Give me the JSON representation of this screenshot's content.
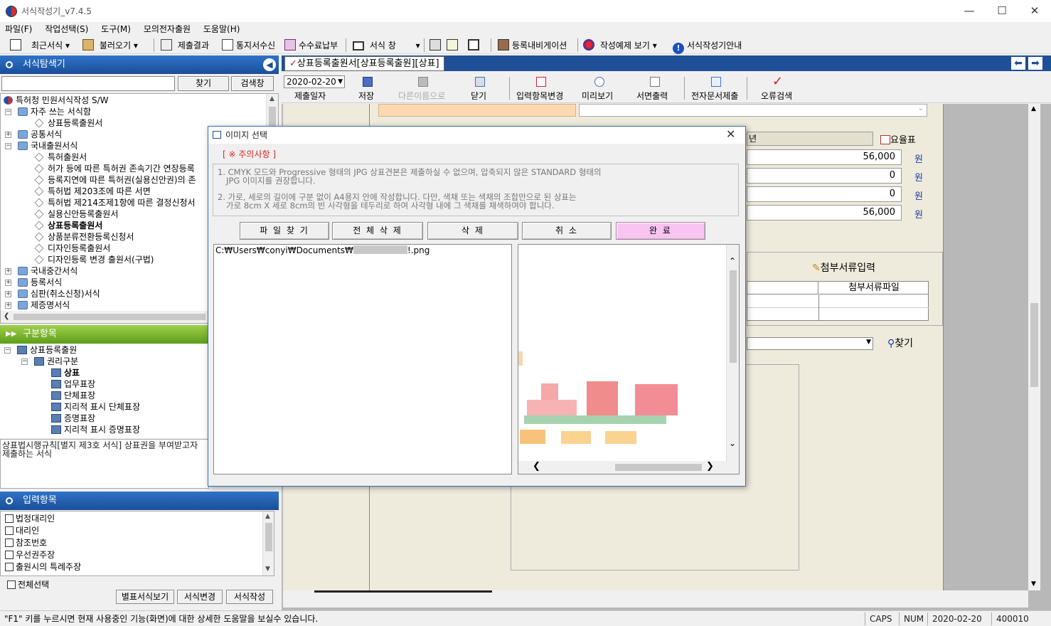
{
  "window": {
    "title": "서식작성기_v7.4.5"
  },
  "menu": [
    "파일(F)",
    "작업선택(S)",
    "도구(M)",
    "모의전자출원",
    "도움말(H)"
  ],
  "toolbar": {
    "recent": "최근서식",
    "load": "불러오기",
    "submit_result": "제출결과",
    "notice_receive": "통지서수신",
    "fee_pay": "수수료납부",
    "form_window": "서식 창",
    "reg_navigation": "등록내비게이션",
    "example_view": "작성예제 보기",
    "guide": "서식작성기안내"
  },
  "explorer": {
    "header": "서식탐색기",
    "find_button": "찾기",
    "search_window_button": "검색창",
    "tree": [
      "특허청 민원서식작성 S/W",
      "자주 쓰는 서식함",
      "상표등록출원서",
      "공통서식",
      "국내출원서식",
      "특허출원서",
      "허가 등에 따른 특허권 존속기간 연장등록",
      "등록지연에 따른 특허권(실용신안권)의 존",
      "특허법 제203조에 따른 서면",
      "특허법 제214조제1항에 따른 결정신청서",
      "실용신안등록출원서",
      "상표등록출원서",
      "상품분류전환등록신청서",
      "디자인등록출원서",
      "디자인등록 변경 출원서(구법)",
      "국내중간서식",
      "등록서식",
      "심판(취소신청)서식",
      "제증명서식"
    ]
  },
  "category": {
    "header": "구분항목",
    "tree": [
      "상표등록출원",
      "권리구분",
      "상표",
      "업무표장",
      "단체표장",
      "지리적 표시 단체표장",
      "증명표장",
      "지리적 표시 증명표장"
    ],
    "description": "상표법시행규칙[별지 제3호 서식] 상표권을 부여받고자 제출하는 서식"
  },
  "inputs": {
    "header": "입력항목",
    "items": [
      "법정대리인",
      "대리인",
      "참조번호",
      "우선권주장",
      "출원시의 특례주장"
    ],
    "select_all": "전체선택",
    "btn_appendix": "별표서식보기",
    "btn_change": "서식변경",
    "btn_write": "서식작성"
  },
  "document": {
    "tab": "상표등록출원서[상표등록출원][상표]",
    "date": "2020-02-20",
    "toolbar": [
      "제출일자",
      "저장",
      "다른이름으로",
      "닫기",
      "입력항목변경",
      "미리보기",
      "서면출력",
      "전자문서제출",
      "오류검색"
    ],
    "fee_label": "요율표",
    "fees": [
      "56,000",
      "0",
      "0",
      "56,000"
    ],
    "won": "원",
    "attach_input": "첨부서류입력",
    "attach_file_col": "첨부서류파일",
    "find": "찾기"
  },
  "dialog": {
    "title": "이미지 선택",
    "notice_title": "[ ※ 주의사항 ]",
    "note1a": "1. CMYK 모드와 Progressive 형태의 JPG 상표견본은 제출하실 수 없으며, 압축되지 않은 STANDARD 형태의",
    "note1b": "JPG 이미지를 권장합니다.",
    "note2a": "2. 가로, 세로의 길이에 구분 없이 A4용지 안에 작성합니다. 다만, 색채 또는 색채의 조합만으로 된 상표는",
    "note2b": "가로 8cm X 세로 8cm의 빈 사각형을 테두리로 하여 사각형 내에 그 색채를 채색하여야 합니다.",
    "btn_find": "파 일 찾 기",
    "btn_delete_all": "전 체 삭 제",
    "btn_delete": "삭 제",
    "btn_cancel": "취 소",
    "btn_done": "완 료",
    "file_path_prefix": "C:₩Users₩conyi₩Documents₩",
    "file_path_suffix": "!.png"
  },
  "status": {
    "help": "\"F1\" 키를 누르시면 현재 사용중인 기능(화면)에 대한 상세한 도움말을 보실수 있습니다.",
    "caps": "CAPS",
    "num": "NUM",
    "date": "2020-02-20",
    "code": "400010"
  }
}
